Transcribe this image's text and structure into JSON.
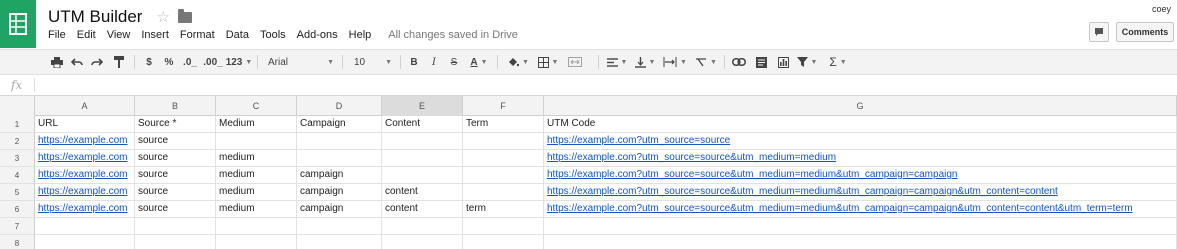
{
  "app": {
    "title": "UTM Builder",
    "user": "coey",
    "save_status": "All changes saved in Drive",
    "menu": [
      "File",
      "Edit",
      "View",
      "Insert",
      "Format",
      "Data",
      "Tools",
      "Add-ons",
      "Help"
    ],
    "comments_label": "Comments",
    "brand_color": "#1fa463"
  },
  "toolbar": {
    "currency": "$",
    "percent": "%",
    "decrease_decimals": ".0_",
    "increase_decimals": ".00_",
    "more_formats": "123",
    "font": "Arial",
    "font_size": "10",
    "bold": "B",
    "italic": "I",
    "strikethrough": "S",
    "text_color": "A",
    "functions": "Σ"
  },
  "formula_bar": {
    "fx_label": "fx",
    "value": ""
  },
  "sheet": {
    "columns": [
      "A",
      "B",
      "C",
      "D",
      "E",
      "F",
      "G"
    ],
    "row_numbers": [
      "1",
      "2",
      "3",
      "4",
      "5",
      "6",
      "7",
      "8"
    ],
    "rows": [
      [
        "URL",
        "Source *",
        "Medium",
        "Campaign",
        "Content",
        "Term",
        "UTM Code"
      ],
      [
        "https://example.com",
        "source",
        "",
        "",
        "",
        "",
        "https://example.com?utm_source=source"
      ],
      [
        "https://example.com",
        "source",
        "medium",
        "",
        "",
        "",
        "https://example.com?utm_source=source&utm_medium=medium"
      ],
      [
        "https://example.com",
        "source",
        "medium",
        "campaign",
        "",
        "",
        "https://example.com?utm_source=source&utm_medium=medium&utm_campaign=campaign"
      ],
      [
        "https://example.com",
        "source",
        "medium",
        "campaign",
        "content",
        "",
        "https://example.com?utm_source=source&utm_medium=medium&utm_campaign=campaign&utm_content=content"
      ],
      [
        "https://example.com",
        "source",
        "medium",
        "campaign",
        "content",
        "term",
        "https://example.com?utm_source=source&utm_medium=medium&utm_campaign=campaign&utm_content=content&utm_term=term"
      ],
      [
        "",
        "",
        "",
        "",
        "",
        "",
        ""
      ],
      [
        "",
        "",
        "",
        "",
        "",
        "",
        ""
      ]
    ],
    "selected_column": "E",
    "link_color": "#1155cc"
  }
}
